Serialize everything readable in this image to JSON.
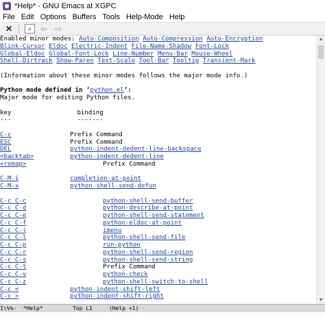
{
  "window": {
    "title": "*Help* - GNU Emacs at XGPC"
  },
  "menu": [
    "File",
    "Edit",
    "Options",
    "Buffers",
    "Tools",
    "Help-Mode",
    "Help"
  ],
  "toolbar": {
    "close_glyph": "✕",
    "search_glyph": "⌕",
    "back_glyph": "⇦",
    "forward_glyph": "⇨"
  },
  "content": {
    "minor_prefix": "Enabled minor modes: ",
    "minor_modes": [
      "Auto-Composition",
      "Auto-Compression",
      "Auto-Encryption",
      "Blink-Cursor",
      "Eldoc",
      "Electric-Indent",
      "File-Name-Shadow",
      "Font-Lock",
      "Global-Eldoc",
      "Global-Font-Lock",
      "Line-Number",
      "Menu-Bar",
      "Mouse-Wheel",
      "Shell-Dirtrack",
      "Show-Paren",
      "Text-Scale",
      "Tool-Bar",
      "Tooltip",
      "Transient-Mark"
    ],
    "info_line": "(Information about these minor modes follows the major mode info.)",
    "python_prefix": "Python mode defined in ‘",
    "python_file": "python.el",
    "python_suffix": "’:",
    "major_line": "Major mode for editing Python files.",
    "header_key": "key",
    "header_binding": "binding",
    "header_key_rule": "---",
    "header_binding_rule": "-------",
    "bindings": [
      {
        "key": "C-c",
        "binding": "Prefix Command",
        "link": false,
        "indent": 1
      },
      {
        "key": "ESC",
        "binding": "Prefix Command",
        "link": false,
        "indent": 1
      },
      {
        "key": "DEL",
        "binding": "python-indent-dedent-line-backspace",
        "link": true,
        "indent": 1
      },
      {
        "key": "<backtab>",
        "binding": "python-indent-dedent-line",
        "link": true,
        "indent": 1
      },
      {
        "key": "<remap>",
        "binding": "Prefix Command",
        "link": false,
        "indent": 2
      },
      {
        "key": "",
        "binding": "",
        "link": false,
        "indent": 1
      },
      {
        "key": "C-M-i",
        "binding": "completion-at-point",
        "link": true,
        "indent": 1
      },
      {
        "key": "C-M-x",
        "binding": "python-shell-send-defun",
        "link": true,
        "indent": 1
      },
      {
        "key": "",
        "binding": "",
        "link": false,
        "indent": 1
      },
      {
        "key": "C-c C-c",
        "binding": "python-shell-send-buffer",
        "link": true,
        "indent": 2
      },
      {
        "key": "C-c C-d",
        "binding": "python-describe-at-point",
        "link": true,
        "indent": 2
      },
      {
        "key": "C-c C-e",
        "binding": "python-shell-send-statement",
        "link": true,
        "indent": 2
      },
      {
        "key": "C-c C-f",
        "binding": "python-eldoc-at-point",
        "link": true,
        "indent": 2
      },
      {
        "key": "C-c C-j",
        "binding": "imenu",
        "link": true,
        "indent": 2
      },
      {
        "key": "C-c C-l",
        "binding": "python-shell-send-file",
        "link": true,
        "indent": 2
      },
      {
        "key": "C-c C-p",
        "binding": "run-python",
        "link": true,
        "indent": 2
      },
      {
        "key": "C-c C-r",
        "binding": "python-shell-send-region",
        "link": true,
        "indent": 2
      },
      {
        "key": "C-c C-s",
        "binding": "python-shell-send-string",
        "link": true,
        "indent": 2
      },
      {
        "key": "C-c C-t",
        "binding": "Prefix Command",
        "link": false,
        "indent": 2
      },
      {
        "key": "C-c C-v",
        "binding": "python-check",
        "link": true,
        "indent": 2
      },
      {
        "key": "C-c C-z",
        "binding": "python-shell-switch-to-shell",
        "link": true,
        "indent": 2
      },
      {
        "key": "C-c <",
        "binding": "python-indent-shift-left",
        "link": true,
        "indent": 1
      },
      {
        "key": "C-c >",
        "binding": "python-indent-shift-right",
        "link": true,
        "indent": 1
      }
    ]
  },
  "modeline": {
    "text": "1\\%%-  *Help*         Top L1     (Help +1)"
  },
  "colors": {
    "link": "#1c3fa6",
    "modeline_bg": "#d9d9d9",
    "toolbar_bg": "#f0f0f0"
  }
}
